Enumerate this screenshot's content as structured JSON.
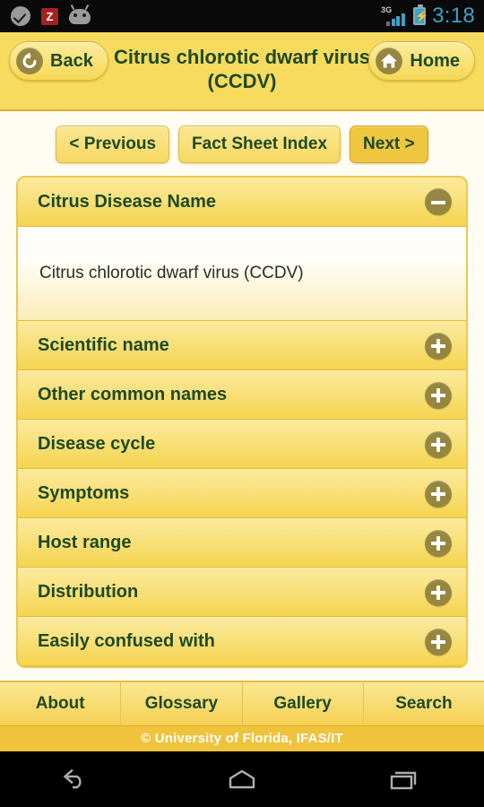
{
  "status_bar": {
    "icons": [
      "check-blob-icon",
      "zedge-icon",
      "android-face-icon"
    ],
    "zedge_label": "Z",
    "network_label": "3G",
    "battery_glyph": "⚡",
    "time": "3:18"
  },
  "header": {
    "back_label": "Back",
    "back_icon": "undo-arrow-icon",
    "home_label": "Home",
    "home_icon": "house-icon",
    "title": "Citrus chlorotic dwarf virus (CCDV)"
  },
  "pager": {
    "previous_label": "< Previous",
    "index_label": "Fact Sheet Index",
    "next_label": "Next >"
  },
  "sections": [
    {
      "title": "Citrus Disease Name",
      "expanded": true,
      "toggle_icon": "minus-circle-icon",
      "body": "Citrus chlorotic dwarf virus (CCDV)"
    },
    {
      "title": "Scientific name",
      "expanded": false,
      "toggle_icon": "plus-circle-icon"
    },
    {
      "title": "Other common names",
      "expanded": false,
      "toggle_icon": "plus-circle-icon"
    },
    {
      "title": "Disease cycle",
      "expanded": false,
      "toggle_icon": "plus-circle-icon"
    },
    {
      "title": "Symptoms",
      "expanded": false,
      "toggle_icon": "plus-circle-icon"
    },
    {
      "title": "Host range",
      "expanded": false,
      "toggle_icon": "plus-circle-icon"
    },
    {
      "title": "Distribution",
      "expanded": false,
      "toggle_icon": "plus-circle-icon"
    },
    {
      "title": "Easily confused with",
      "expanded": false,
      "toggle_icon": "plus-circle-icon"
    }
  ],
  "tabs": [
    {
      "label": "About"
    },
    {
      "label": "Glossary"
    },
    {
      "label": "Gallery"
    },
    {
      "label": "Search"
    }
  ],
  "copyright": "© University of Florida, IFAS/IT",
  "system_nav": {
    "back_icon": "system-back-icon",
    "home_icon": "system-home-icon",
    "recents_icon": "system-recents-icon"
  },
  "colors": {
    "brand_yellow": "#F7DB5E",
    "accent_gold": "#EFC63F",
    "text_green": "#1E4A24",
    "icon_olive": "#958640",
    "status_blue": "#3EA0C8"
  }
}
